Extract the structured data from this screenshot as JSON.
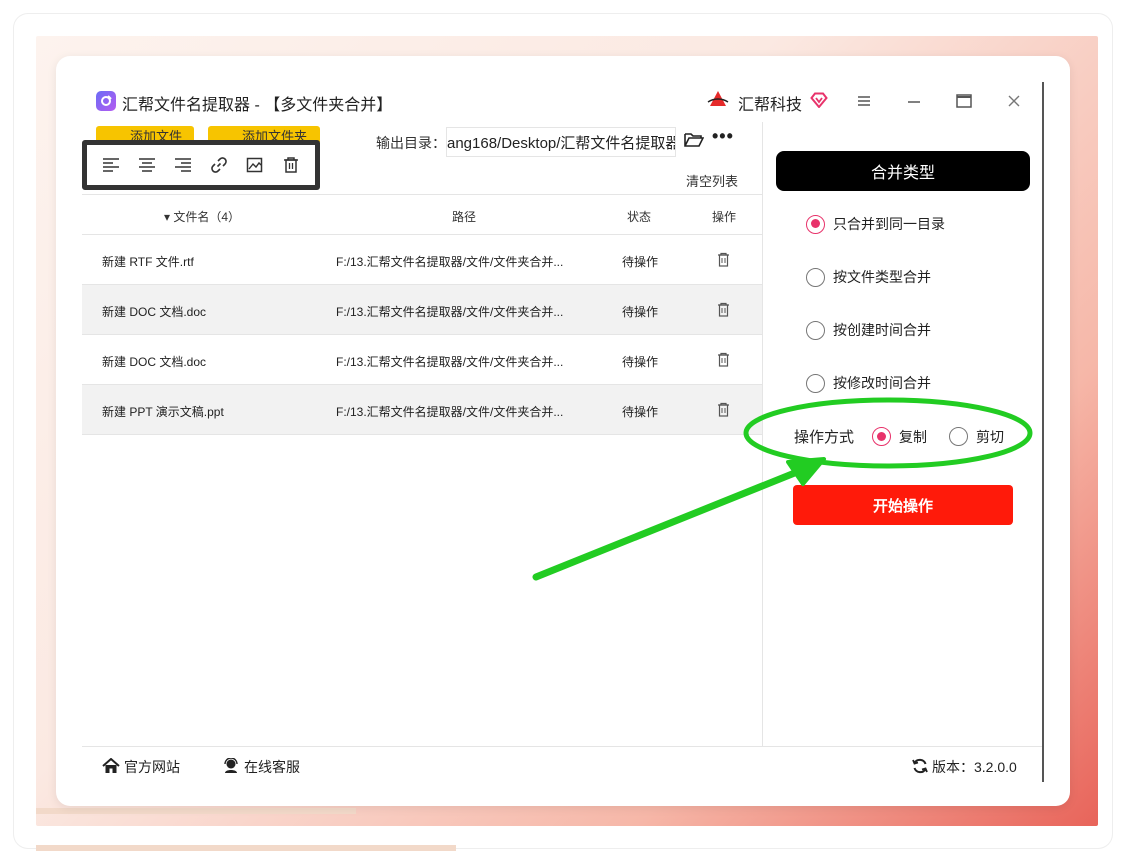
{
  "window": {
    "title": "汇帮文件名提取器 - 【多文件夹合并】",
    "brand": "汇帮科技"
  },
  "toolbar": {
    "add_file": "添加文件",
    "add_folder": "添加文件夹",
    "output_label": "输出目录：",
    "output_path": "ang168/Desktop/汇帮文件名提取器",
    "more": "•••",
    "clear_list": "清空列表"
  },
  "align_bar": {
    "icons": [
      "align-left-icon",
      "align-center-icon",
      "align-right-icon",
      "link-icon",
      "image-edit-icon",
      "trash-icon"
    ]
  },
  "table": {
    "headers": {
      "name": "▾ 文件名（4）",
      "path": "路径",
      "status": "状态",
      "action": "操作"
    },
    "rows": [
      {
        "name": "新建 RTF 文件.rtf",
        "path": "F:/13.汇帮文件名提取器/文件/文件夹合并...",
        "status": "待操作"
      },
      {
        "name": "新建 DOC 文档.doc",
        "path": "F:/13.汇帮文件名提取器/文件/文件夹合并...",
        "status": "待操作"
      },
      {
        "name": "新建 DOC 文档.doc",
        "path": "F:/13.汇帮文件名提取器/文件/文件夹合并...",
        "status": "待操作"
      },
      {
        "name": "新建 PPT 演示文稿.ppt",
        "path": "F:/13.汇帮文件名提取器/文件/文件夹合并...",
        "status": "待操作"
      }
    ]
  },
  "panel": {
    "header": "合并类型",
    "options": [
      {
        "label": "只合并到同一目录",
        "selected": true
      },
      {
        "label": "按文件类型合并",
        "selected": false
      },
      {
        "label": "按创建时间合并",
        "selected": false
      },
      {
        "label": "按修改时间合并",
        "selected": false
      }
    ],
    "op_label": "操作方式",
    "op_copy": "复制",
    "op_cut": "剪切",
    "start": "开始操作"
  },
  "footer": {
    "website": "官方网站",
    "support": "在线客服",
    "version": "版本：3.2.0.0"
  },
  "colors": {
    "accent": "#e8336b",
    "start_button": "#ff1a0a",
    "annotation": "#22cc22",
    "toolbar_yellow": "#f7c400"
  }
}
